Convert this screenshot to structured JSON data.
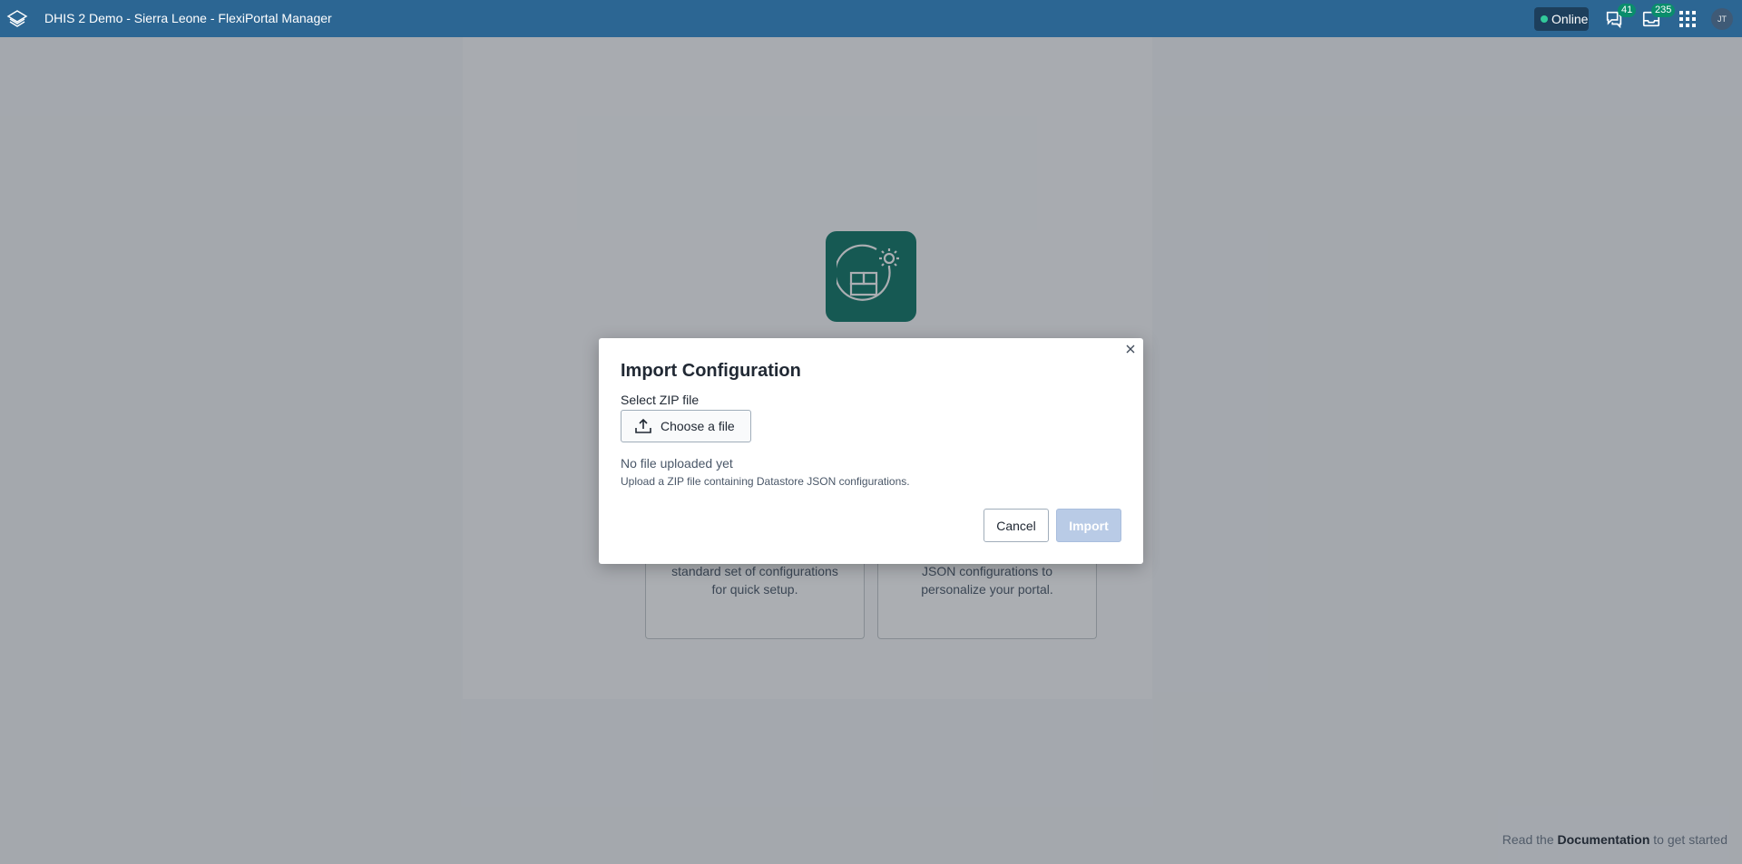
{
  "header": {
    "title": "DHIS 2 Demo - Sierra Leone - FlexiPortal Manager",
    "status_label": "Online",
    "messages_count": "41",
    "interpretations_count": "235",
    "avatar_initials": "JT"
  },
  "background": {
    "card_left_text_line1": "standard set of configurations",
    "card_left_text_line2": "for quick setup.",
    "card_right_text_line1": "JSON configurations to",
    "card_right_text_line2": "personalize your portal.",
    "footer_prefix": "Read the",
    "footer_link": "Documentation",
    "footer_suffix": "to get started"
  },
  "modal": {
    "title": "Import Configuration",
    "field_label": "Select ZIP file",
    "choose_file_label": "Choose a file",
    "status_text": "No file uploaded yet",
    "help_text": "Upload a ZIP file containing Datastore JSON configurations.",
    "cancel_label": "Cancel",
    "import_label": "Import"
  },
  "colors": {
    "header_bg": "#2c6693",
    "brand_icon_bg": "#0f7666",
    "badge_bg": "#0a8d6c",
    "online_dot": "#32c99a",
    "import_disabled": "#b9cbe6"
  },
  "icons": {
    "logo": "dhis2-logo-icon",
    "messages": "chat-icon",
    "interpretations": "inbox-icon",
    "apps": "apps-grid-icon",
    "hero": "portal-settings-icon",
    "close": "close-icon",
    "upload": "upload-icon"
  }
}
